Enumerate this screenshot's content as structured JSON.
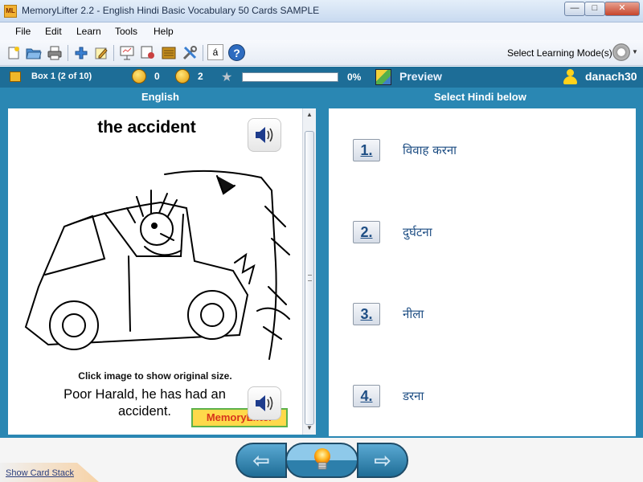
{
  "window": {
    "title": "MemoryLifter 2.2 - English Hindi Basic Vocabulary 50 Cards SAMPLE",
    "app_icon_text": "ML",
    "minimize": "—",
    "maximize": "□",
    "close": "✕"
  },
  "menu": {
    "items": [
      "File",
      "Edit",
      "Learn",
      "Tools",
      "Help"
    ]
  },
  "toolbar": {
    "icons": [
      "new-document-icon",
      "open-folder-icon",
      "print-icon",
      "add-icon",
      "edit-icon",
      "presentation-icon",
      "slideshow-icon",
      "card-box-icon",
      "settings-tools-icon",
      "special-characters-icon",
      "help-icon"
    ],
    "special_char": "á",
    "help": "?",
    "learning_mode_label": "Select Learning Mode(s)"
  },
  "status": {
    "box_label": "Box 1   (2 of 10)",
    "correct_count": "0",
    "wrong_count": "2",
    "progress_percent": 0,
    "progress_text": "0%",
    "preview_label": "Preview",
    "username": "danach30"
  },
  "question": {
    "column_header": "English",
    "word": "the accident",
    "image_hint": "Click image to show original size.",
    "example_sentence": "Poor Harald, he has had an accident.",
    "logo_text": "MemoryLifter"
  },
  "answers": {
    "column_header": "Select Hindi below",
    "options": [
      {
        "number": "1.",
        "text": "विवाह करना"
      },
      {
        "number": "2.",
        "text": "दुर्घटना"
      },
      {
        "number": "3.",
        "text": "नीला"
      },
      {
        "number": "4.",
        "text": "डरना"
      }
    ]
  },
  "bottom": {
    "show_card_stack": "Show Card Stack",
    "back_arrow": "⇦",
    "next_arrow": "⇨"
  },
  "colors": {
    "status_bar": "#1d6d97",
    "main_bg": "#2a87b3",
    "answer_text": "#1e4e84"
  }
}
